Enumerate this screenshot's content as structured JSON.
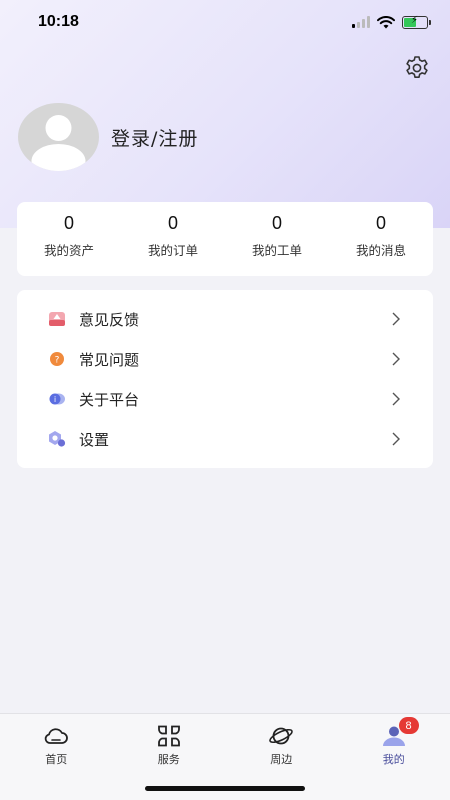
{
  "status_bar": {
    "time": "10:18",
    "icons": [
      "signal-icon",
      "wifi-icon",
      "battery-charging-icon"
    ]
  },
  "header": {
    "settings_icon": "gear-icon"
  },
  "profile": {
    "avatar_icon": "default-avatar",
    "login_text": "登录/注册"
  },
  "stats": [
    {
      "value": "0",
      "label": "我的资产"
    },
    {
      "value": "0",
      "label": "我的订单"
    },
    {
      "value": "0",
      "label": "我的工单"
    },
    {
      "value": "0",
      "label": "我的消息"
    }
  ],
  "menu": [
    {
      "label": "意见反馈",
      "icon": "feedback-icon",
      "color": "#e35d6a"
    },
    {
      "label": "常见问题",
      "icon": "question-icon",
      "color": "#f08a3c"
    },
    {
      "label": "关于平台",
      "icon": "info-icon",
      "color": "#5b6ee1"
    },
    {
      "label": "设置",
      "icon": "settings-icon",
      "color": "#6b6fd6"
    }
  ],
  "tabs": [
    {
      "label": "首页",
      "icon": "cloud-home-icon"
    },
    {
      "label": "服务",
      "icon": "grid-services-icon"
    },
    {
      "label": "周边",
      "icon": "planet-nearby-icon"
    },
    {
      "label": "我的",
      "icon": "user-icon",
      "active": true,
      "badge": "8"
    }
  ],
  "colors": {
    "accent": "#4a4e9c",
    "badge": "#e53935",
    "header_gradient_end": "#d9d4f7"
  }
}
